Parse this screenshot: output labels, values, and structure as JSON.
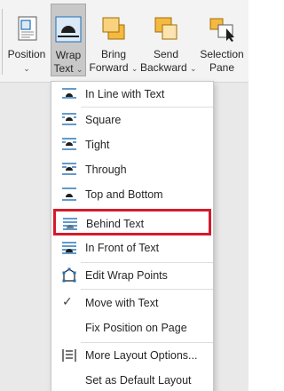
{
  "ribbon": {
    "position": {
      "label": "Position",
      "icon": "position-icon"
    },
    "wrap_text": {
      "line1": "Wrap",
      "line2": "Text",
      "icon": "wrap-text-icon"
    },
    "bring_forward": {
      "line1": "Bring",
      "line2": "Forward",
      "icon": "bring-forward-icon"
    },
    "send_backward": {
      "line1": "Send",
      "line2": "Backward",
      "icon": "send-backward-icon"
    },
    "selection_pane": {
      "line1": "Selection",
      "line2": "Pane",
      "icon": "selection-pane-icon"
    }
  },
  "menu": {
    "items": [
      {
        "label": "In Line with Text",
        "icon": "inline-with-text-icon"
      },
      {
        "label": "Square",
        "icon": "square-wrap-icon"
      },
      {
        "label": "Tight",
        "icon": "tight-wrap-icon"
      },
      {
        "label": "Through",
        "icon": "through-wrap-icon"
      },
      {
        "label": "Top and Bottom",
        "icon": "top-bottom-wrap-icon"
      },
      {
        "label": "Behind Text",
        "icon": "behind-text-icon",
        "highlighted": true
      },
      {
        "label": "In Front of Text",
        "icon": "in-front-of-text-icon"
      },
      {
        "label": "Edit Wrap Points",
        "icon": "edit-wrap-points-icon"
      },
      {
        "label": "Move with Text",
        "icon": "checkmark-icon",
        "checked": true
      },
      {
        "label": "Fix Position on Page",
        "icon": ""
      },
      {
        "label": "More Layout Options...",
        "icon": "layout-options-icon"
      },
      {
        "label": "Set as Default Layout",
        "icon": ""
      }
    ]
  },
  "colors": {
    "highlight_border": "#d51a2b",
    "icon_blue": "#1f6fb7",
    "icon_orange": "#f4b942"
  }
}
